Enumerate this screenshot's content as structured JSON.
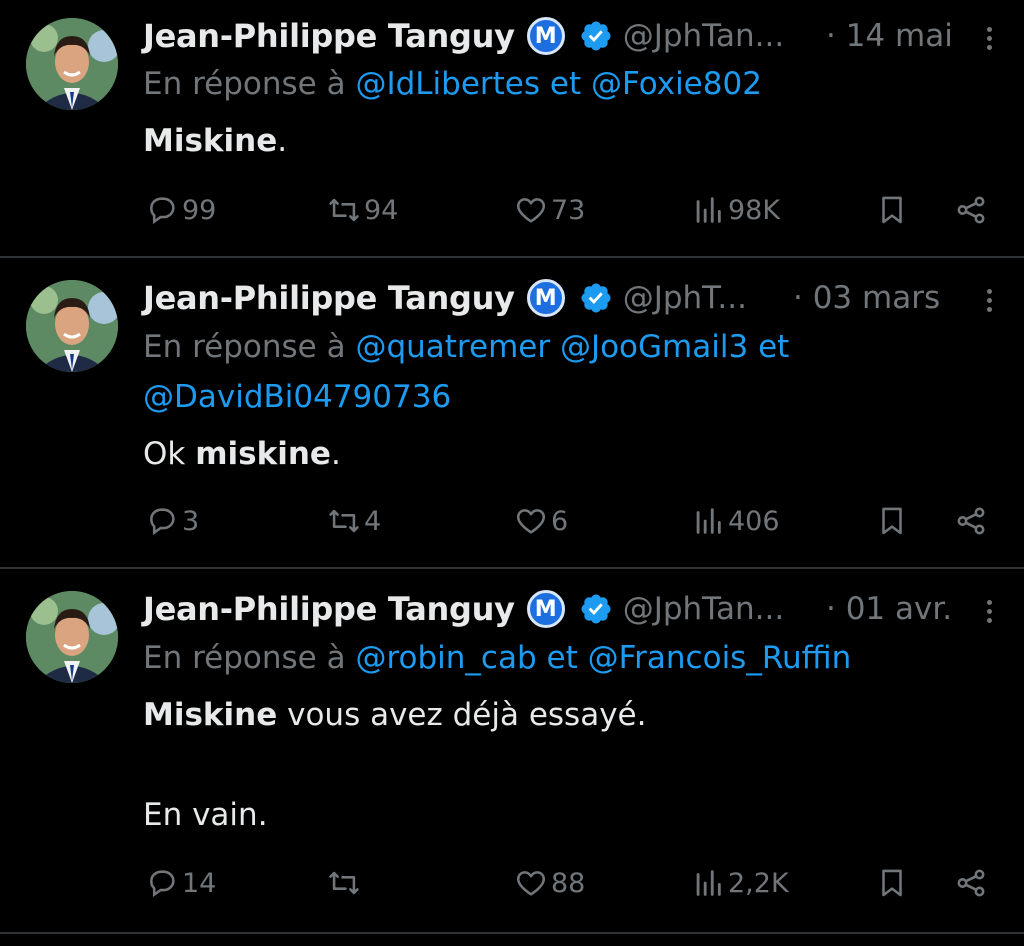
{
  "colors": {
    "background": "#000000",
    "text": "#e7e9ea",
    "muted": "#71767b",
    "link": "#1d9bf0",
    "divider": "#2f3336"
  },
  "tweets": [
    {
      "name": "Jean-Philippe Tanguy",
      "badge": "M",
      "handle": "@JphTan...",
      "date": "· 14 mai",
      "reply_prefix": "En réponse à",
      "reply_mention_1": "@IdLibertes",
      "reply_joiner": "et",
      "reply_mention_2": "@Foxie802",
      "body_bold": "Miskine",
      "body_rest": ".",
      "replies": "99",
      "retweets": "94",
      "likes": "73",
      "views": "98K"
    },
    {
      "name": "Jean-Philippe Tanguy",
      "badge": "M",
      "handle": "@JphT...",
      "date": "· 03 mars",
      "reply_prefix": "En réponse à",
      "reply_mention_1": "@quatremer",
      "reply_mention_2": "@JooGmail3",
      "reply_joiner": "et",
      "reply_mention_3": "@DavidBi04790736",
      "body_pre": "Ok ",
      "body_bold": "miskine",
      "body_rest": ".",
      "replies": "3",
      "retweets": "4",
      "likes": "6",
      "views": "406"
    },
    {
      "name": "Jean-Philippe Tanguy",
      "badge": "M",
      "handle": "@JphTan...",
      "date": "· 01 avr.",
      "reply_prefix": "En réponse à",
      "reply_mention_1": "@robin_cab",
      "reply_joiner": "et",
      "reply_mention_2": "@Francois_Ruffin",
      "body_bold": "Miskine",
      "body_rest": " vous avez déjà essayé.",
      "body_line2": "En vain.",
      "replies": "14",
      "retweets": "",
      "likes": "88",
      "views": "2,2K"
    }
  ],
  "icons": {
    "reply": "speech-bubble-icon",
    "retweet": "retweet-icon",
    "like": "heart-icon",
    "views": "bar-chart-icon",
    "bookmark": "bookmark-icon",
    "share": "share-icon",
    "more": "more-dots-icon",
    "verified": "verified-check-icon"
  }
}
